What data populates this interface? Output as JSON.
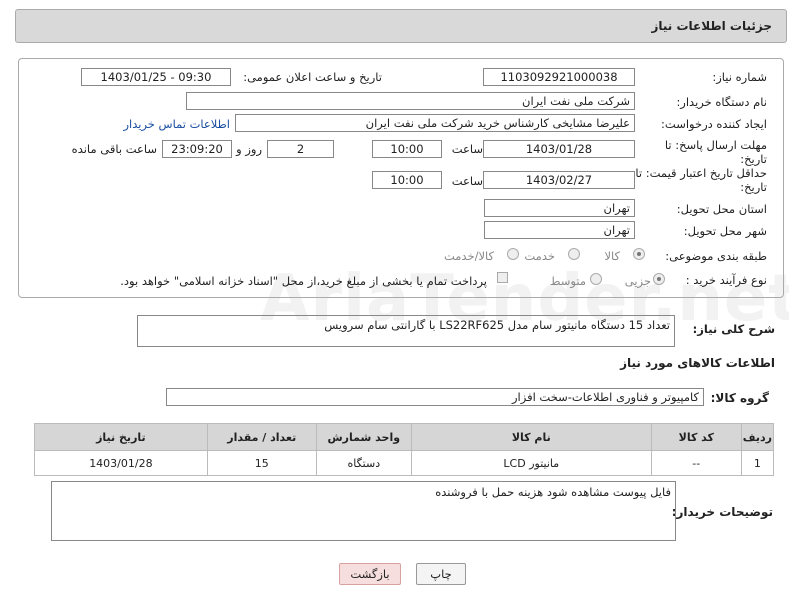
{
  "header": {
    "title": "جزئیات اطلاعات نیاز"
  },
  "watermark": {
    "text": "AriaTender.net"
  },
  "form": {
    "need_number_label": "شماره نیاز:",
    "need_number": "1103092921000038",
    "announce_label": "تاریخ و ساعت اعلان عمومی:",
    "announce_value": "1403/01/25 - 09:30",
    "buyer_org_label": "نام دستگاه خریدار:",
    "buyer_org": "شرکت ملی نفت ایران",
    "requester_label": "ایجاد کننده درخواست:",
    "requester": "علیرضا مشایخی کارشناس خرید  شرکت ملی نفت ایران",
    "contact_link": "اطلاعات تماس خریدار",
    "reply_deadline_label": "مهلت ارسال پاسخ: تا تاریخ:",
    "reply_date": "1403/01/28",
    "time_label": "ساعت",
    "reply_time": "10:00",
    "days_value": "2",
    "days_label": "روز و",
    "remaining_time": "23:09:20",
    "remaining_label": "ساعت باقی مانده",
    "price_deadline_label": "حداقل تاریخ اعتبار قیمت: تا تاریخ:",
    "price_date": "1403/02/27",
    "price_time": "10:00",
    "province_label": "استان محل تحویل:",
    "province": "تهران",
    "city_label": "شهر محل تحویل:",
    "city": "تهران",
    "category_label": "طبقه بندی موضوعی:",
    "category_options": [
      "کالا",
      "خدمت",
      "کالا/خدمت"
    ],
    "purchase_label": "نوع فرآیند خرید :",
    "purchase_options": [
      "جزیی",
      "متوسط"
    ],
    "payment_note": "پرداخت تمام یا بخشی از مبلغ خرید،از محل \"اسناد خزانه اسلامی\" خواهد بود."
  },
  "description": {
    "label": "شرح کلی نیاز:",
    "text": "تعداد 15 دستگاه مانیتور سام مدل LS22RF625 با گارانتی سام سرویس"
  },
  "goods": {
    "section_title": "اطلاعات کالاهای مورد نیاز",
    "group_label": "گروه کالا:",
    "group_value": "کامپیوتر و فناوری اطلاعات-سخت افزار",
    "columns": [
      "ردیف",
      "کد کالا",
      "نام کالا",
      "واحد شمارش",
      "تعداد / مقدار",
      "تاریخ نیاز"
    ],
    "rows": [
      {
        "row": "1",
        "code": "--",
        "name": "مانیتور LCD",
        "unit": "دستگاه",
        "qty": "15",
        "date": "1403/01/28"
      }
    ]
  },
  "buyer_notes": {
    "label": "توضیحات خریدار:",
    "text": "فایل پیوست مشاهده شود هزینه حمل با فروشنده"
  },
  "actions": {
    "print": "چاپ",
    "back": "بازگشت"
  }
}
